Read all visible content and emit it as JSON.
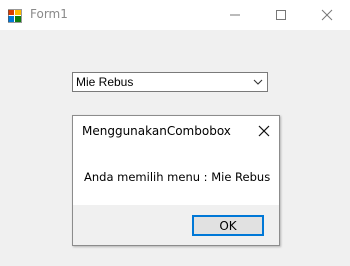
{
  "window": {
    "title": "Form1",
    "icons": {
      "app": "form-app-icon",
      "minimize": "minimize-icon",
      "maximize": "maximize-icon",
      "close": "close-icon"
    }
  },
  "combobox": {
    "selected_value": "Mie Rebus",
    "dropdown_icon": "chevron-down-icon"
  },
  "dialog": {
    "title": "MenggunakanCombobox",
    "message": "Anda memilih menu : Mie Rebus",
    "ok_label": "OK",
    "close_icon": "close-icon"
  },
  "colors": {
    "title_text": "#8a8a8a",
    "window_bg": "#f0f0f0",
    "ok_border_accent": "#0078d7"
  }
}
